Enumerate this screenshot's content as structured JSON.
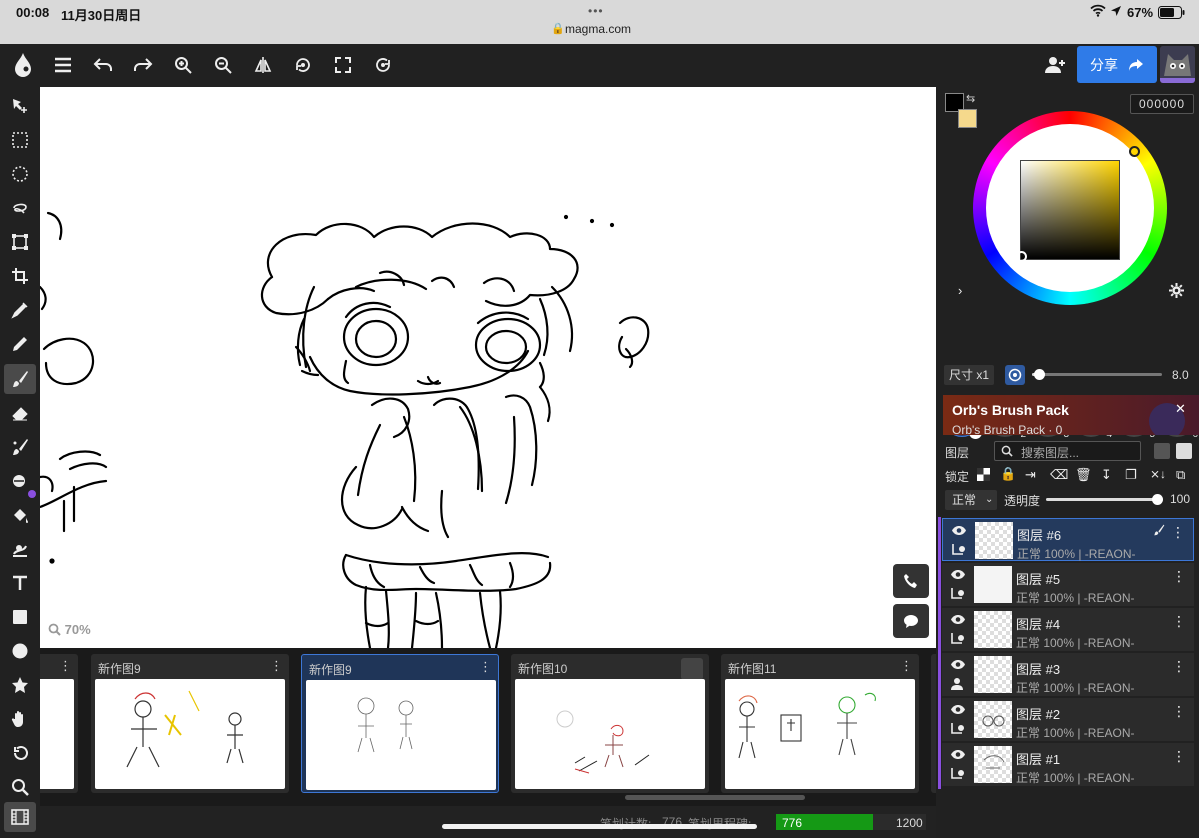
{
  "status": {
    "time": "00:08",
    "date": "11月30日周日",
    "url": "magma.com",
    "battery": "67%"
  },
  "toolbar": {
    "share_label": "分享"
  },
  "canvas": {
    "zoom": "70%"
  },
  "frames": [
    {
      "title": "新作图9",
      "selected": false
    },
    {
      "title": "新作图9",
      "selected": true
    },
    {
      "title": "新作图10",
      "selected": false
    },
    {
      "title": "新作图11",
      "selected": false
    }
  ],
  "footer": {
    "stroke_count_label": "笔划计数:",
    "stroke_count": "776",
    "milestone_label": "笔划里程碑:",
    "milestone_value": "776",
    "milestone_max": "1200",
    "milestone_progress": 0.6467
  },
  "color": {
    "hex": "000000",
    "primary": "#000000",
    "secondary": "#f5d98c",
    "hue": "#ffd400"
  },
  "brushes": [
    {
      "number": "1",
      "kind": "brush"
    },
    {
      "number": "2",
      "kind": "brush"
    },
    {
      "number": "3",
      "kind": "add"
    },
    {
      "number": "4",
      "kind": "add"
    },
    {
      "number": "5",
      "kind": "add"
    },
    {
      "number": "6",
      "kind": "add"
    }
  ],
  "size": {
    "label": "尺寸 x1",
    "value": "8.0",
    "fraction": 0.03
  },
  "ad": {
    "title": "Orb's Brush Pack",
    "subtitle": "Orb's Brush Pack · 0"
  },
  "layers_panel": {
    "title": "图层",
    "search_placeholder": "搜索图层...",
    "lock_label": "锁定",
    "blend_mode": "正常",
    "opacity_label": "透明度",
    "opacity_value": "100"
  },
  "layers": [
    {
      "name": "图层 #6",
      "info": "正常 100% | -REAON-",
      "selected": true
    },
    {
      "name": "图层 #5",
      "info": "正常 100% | -REAON-",
      "selected": false
    },
    {
      "name": "图层 #4",
      "info": "正常 100% | -REAON-",
      "selected": false
    },
    {
      "name": "图层 #3",
      "info": "正常 100% | -REAON-",
      "selected": false
    },
    {
      "name": "图层 #2",
      "info": "正常 100% | -REAON-",
      "selected": false
    },
    {
      "name": "图层 #1",
      "info": "正常 100% | -REAON-",
      "selected": false
    }
  ]
}
